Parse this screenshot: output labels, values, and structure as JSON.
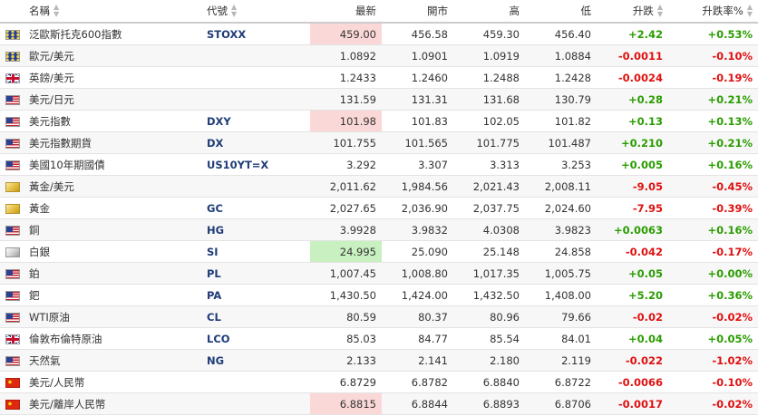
{
  "colors": {
    "up": "#2a9d00",
    "down": "#e01010",
    "highlight_down": "#fbd8d8",
    "highlight_up": "#c8f0c0",
    "symbol": "#1f3c78"
  },
  "headers": {
    "name": "名稱",
    "symbol": "代號",
    "last": "最新",
    "open": "開市",
    "high": "高",
    "low": "低",
    "change": "升跌",
    "change_pct": "升跌率%",
    "sort_icon": "sort-arrows-icon"
  },
  "rows": [
    {
      "flag": "eu",
      "name": "泛歐斯托克600指數",
      "symbol": "STOXX",
      "last": "459.00",
      "last_highlight": "red",
      "open": "456.58",
      "high": "459.30",
      "low": "456.40",
      "change": "+2.42",
      "change_pct": "+0.53%",
      "direction": "up"
    },
    {
      "flag": "eu",
      "name": "歐元/美元",
      "symbol": "",
      "last": "1.0892",
      "last_highlight": "",
      "open": "1.0901",
      "high": "1.0919",
      "low": "1.0884",
      "change": "-0.0011",
      "change_pct": "-0.10%",
      "direction": "down"
    },
    {
      "flag": "gb",
      "name": "英鎊/美元",
      "symbol": "",
      "last": "1.2433",
      "last_highlight": "",
      "open": "1.2460",
      "high": "1.2488",
      "low": "1.2428",
      "change": "-0.0024",
      "change_pct": "-0.19%",
      "direction": "down"
    },
    {
      "flag": "us",
      "name": "美元/日元",
      "symbol": "",
      "last": "131.59",
      "last_highlight": "",
      "open": "131.31",
      "high": "131.68",
      "low": "130.79",
      "change": "+0.28",
      "change_pct": "+0.21%",
      "direction": "up"
    },
    {
      "flag": "us",
      "name": "美元指數",
      "symbol": "DXY",
      "last": "101.98",
      "last_highlight": "red",
      "open": "101.83",
      "high": "102.05",
      "low": "101.82",
      "change": "+0.13",
      "change_pct": "+0.13%",
      "direction": "up"
    },
    {
      "flag": "us",
      "name": "美元指數期貨",
      "symbol": "DX",
      "last": "101.755",
      "last_highlight": "",
      "open": "101.565",
      "high": "101.775",
      "low": "101.487",
      "change": "+0.210",
      "change_pct": "+0.21%",
      "direction": "up"
    },
    {
      "flag": "us",
      "name": "美國10年期國債",
      "symbol": "US10YT=X",
      "last": "3.292",
      "last_highlight": "",
      "open": "3.307",
      "high": "3.313",
      "low": "3.253",
      "change": "+0.005",
      "change_pct": "+0.16%",
      "direction": "up"
    },
    {
      "flag": "gold",
      "name": "黃金/美元",
      "symbol": "",
      "last": "2,011.62",
      "last_highlight": "",
      "open": "1,984.56",
      "high": "2,021.43",
      "low": "2,008.11",
      "change": "-9.05",
      "change_pct": "-0.45%",
      "direction": "down"
    },
    {
      "flag": "gold",
      "name": "黃金",
      "symbol": "GC",
      "last": "2,027.65",
      "last_highlight": "",
      "open": "2,036.90",
      "high": "2,037.75",
      "low": "2,024.60",
      "change": "-7.95",
      "change_pct": "-0.39%",
      "direction": "down"
    },
    {
      "flag": "us",
      "name": "銅",
      "symbol": "HG",
      "last": "3.9928",
      "last_highlight": "",
      "open": "3.9832",
      "high": "4.0308",
      "low": "3.9823",
      "change": "+0.0063",
      "change_pct": "+0.16%",
      "direction": "up"
    },
    {
      "flag": "silver",
      "name": "白銀",
      "symbol": "SI",
      "last": "24.995",
      "last_highlight": "green",
      "open": "25.090",
      "high": "25.148",
      "low": "24.858",
      "change": "-0.042",
      "change_pct": "-0.17%",
      "direction": "down"
    },
    {
      "flag": "us",
      "name": "鉑",
      "symbol": "PL",
      "last": "1,007.45",
      "last_highlight": "",
      "open": "1,008.80",
      "high": "1,017.35",
      "low": "1,005.75",
      "change": "+0.05",
      "change_pct": "+0.00%",
      "direction": "up"
    },
    {
      "flag": "us",
      "name": "鈀",
      "symbol": "PA",
      "last": "1,430.50",
      "last_highlight": "",
      "open": "1,424.00",
      "high": "1,432.50",
      "low": "1,408.00",
      "change": "+5.20",
      "change_pct": "+0.36%",
      "direction": "up"
    },
    {
      "flag": "us",
      "name": "WTI原油",
      "symbol": "CL",
      "last": "80.59",
      "last_highlight": "",
      "open": "80.37",
      "high": "80.96",
      "low": "79.66",
      "change": "-0.02",
      "change_pct": "-0.02%",
      "direction": "down"
    },
    {
      "flag": "gb",
      "name": "倫敦布倫特原油",
      "symbol": "LCO",
      "last": "85.03",
      "last_highlight": "",
      "open": "84.77",
      "high": "85.54",
      "low": "84.01",
      "change": "+0.04",
      "change_pct": "+0.05%",
      "direction": "up"
    },
    {
      "flag": "us",
      "name": "天然氣",
      "symbol": "NG",
      "last": "2.133",
      "last_highlight": "",
      "open": "2.141",
      "high": "2.180",
      "low": "2.119",
      "change": "-0.022",
      "change_pct": "-1.02%",
      "direction": "down"
    },
    {
      "flag": "cn",
      "name": "美元/人民幣",
      "symbol": "",
      "last": "6.8729",
      "last_highlight": "",
      "open": "6.8782",
      "high": "6.8840",
      "low": "6.8722",
      "change": "-0.0066",
      "change_pct": "-0.10%",
      "direction": "down"
    },
    {
      "flag": "cn",
      "name": "美元/離岸人民幣",
      "symbol": "",
      "last": "6.8815",
      "last_highlight": "red",
      "open": "6.8844",
      "high": "6.8893",
      "low": "6.8706",
      "change": "-0.0017",
      "change_pct": "-0.02%",
      "direction": "down"
    }
  ]
}
